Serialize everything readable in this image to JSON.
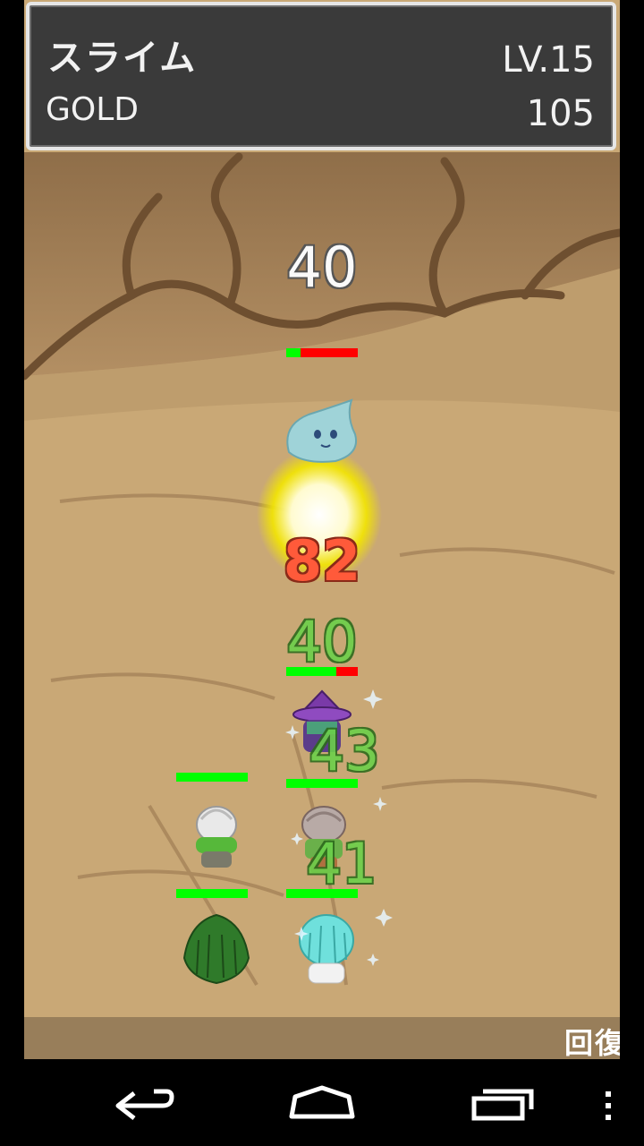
{
  "status": {
    "name": "スライム",
    "level": "LV.15",
    "gold_label": "GOLD",
    "gold_value": "105"
  },
  "battle": {
    "enemy_damage": "40",
    "big_hit": "82",
    "heal_1": "40",
    "heal_2": "43",
    "heal_3": "41",
    "enemy_hp_fraction": 0.2,
    "hero_hp_fractions": [
      0.7,
      1.0,
      1.0,
      1.0,
      1.0
    ]
  },
  "command": {
    "label": "回復"
  },
  "colors": {
    "hp_fill": "#00ff00",
    "hp_empty": "#ff0000",
    "damage_red": "#ff5a3a",
    "heal_green": "#6bd04a"
  },
  "icons": [
    "back-icon",
    "home-icon",
    "recents-icon",
    "menu-icon"
  ]
}
